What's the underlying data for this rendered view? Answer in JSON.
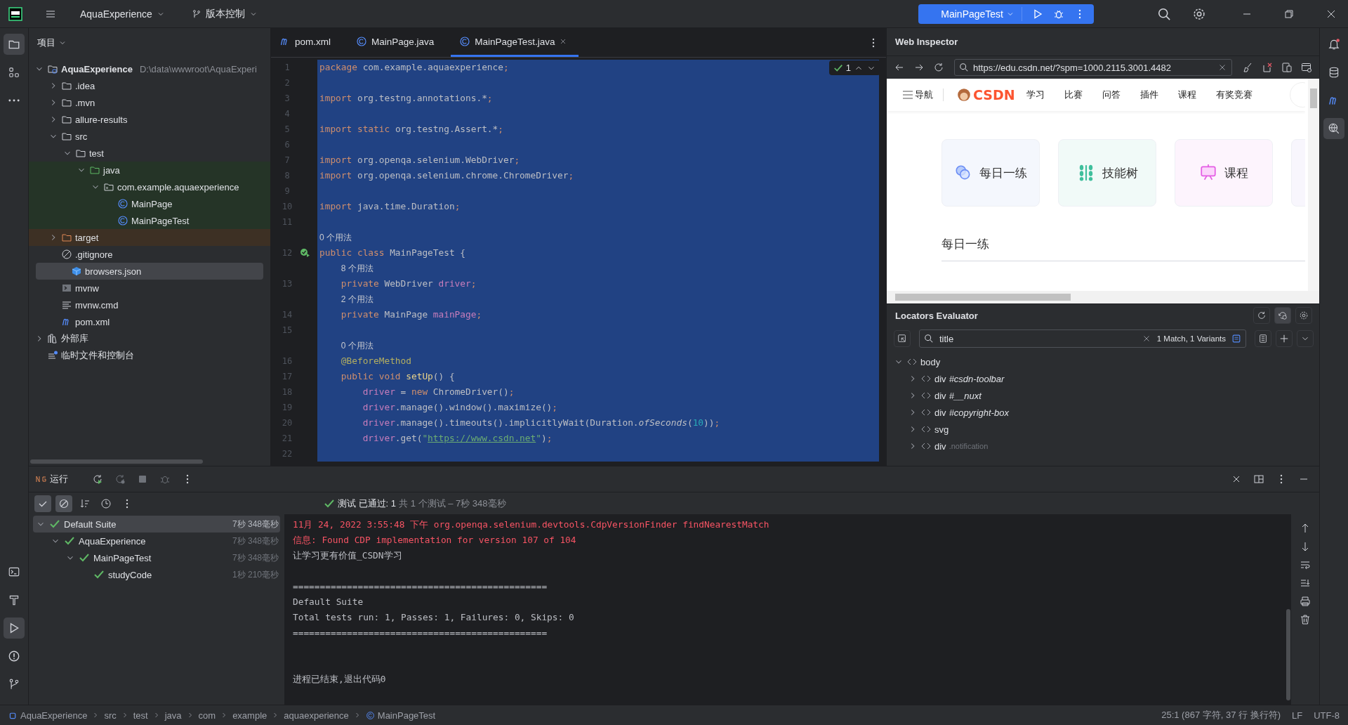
{
  "title_bar": {
    "project": "AquaExperience",
    "vcs": "版本控制",
    "run_config": "MainPageTest"
  },
  "tool_windows": {
    "left_top": [
      {
        "kind": "project",
        "selected": true
      },
      {
        "kind": "structure",
        "selected": false
      },
      {
        "kind": "more",
        "selected": false
      }
    ],
    "left_bottom": [
      {
        "kind": "terminal",
        "selected": false
      },
      {
        "kind": "build",
        "selected": false
      },
      {
        "kind": "run",
        "selected": true
      },
      {
        "kind": "problems",
        "selected": false
      },
      {
        "kind": "git",
        "selected": false
      }
    ],
    "right": [
      {
        "kind": "notifications",
        "selected": false
      },
      {
        "kind": "database",
        "selected": false
      },
      {
        "kind": "maven",
        "selected": false
      },
      {
        "kind": "inspector",
        "selected": true
      }
    ]
  },
  "project_panel": {
    "title": "项目",
    "tree": [
      {
        "name": "AquaExperience",
        "path": "D:\\data\\wwwroot\\AquaExperi",
        "kind": "module",
        "expanded": true,
        "selected": false,
        "children": [
          {
            "name": ".idea",
            "kind": "folder",
            "expanded": false,
            "selected": false
          },
          {
            "name": ".mvn",
            "kind": "folder",
            "expanded": false,
            "selected": false
          },
          {
            "name": "allure-results",
            "kind": "folder",
            "expanded": false,
            "selected": false
          },
          {
            "name": "src",
            "kind": "folder",
            "expanded": true,
            "selected": false,
            "children": [
              {
                "name": "test",
                "kind": "folder",
                "expanded": true,
                "selected": false,
                "children": [
                  {
                    "name": "java",
                    "kind": "source",
                    "test_scope": true,
                    "expanded": true,
                    "selected": false,
                    "children": [
                      {
                        "name": "com.example.aquaexperience",
                        "kind": "package",
                        "test_scope": true,
                        "expanded": true,
                        "selected": false,
                        "children": [
                          {
                            "name": "MainPage",
                            "kind": "class",
                            "test_scope": true,
                            "selected": false
                          },
                          {
                            "name": "MainPageTest",
                            "kind": "class",
                            "test_scope": true,
                            "selected": false
                          }
                        ]
                      }
                    ]
                  }
                ]
              }
            ]
          },
          {
            "name": "target",
            "kind": "excluded",
            "expanded": false,
            "selected": false
          },
          {
            "name": ".gitignore",
            "kind": "gitignore",
            "selected": false
          },
          {
            "name": "browsers.json",
            "kind": "json",
            "selected": true
          },
          {
            "name": "mvnw",
            "kind": "shell",
            "selected": false
          },
          {
            "name": "mvnw.cmd",
            "kind": "text",
            "selected": false
          },
          {
            "name": "pom.xml",
            "kind": "maven",
            "selected": false
          }
        ]
      },
      {
        "name": "外部库",
        "kind": "library",
        "expanded": false,
        "selected": false
      },
      {
        "name": "临时文件和控制台",
        "kind": "scratch",
        "selected": false
      }
    ]
  },
  "editor": {
    "tabs": [
      {
        "label": "pom.xml",
        "kind": "maven",
        "selected": false,
        "closable": false
      },
      {
        "label": "MainPage.java",
        "kind": "class",
        "selected": false,
        "closable": false
      },
      {
        "label": "MainPageTest.java",
        "kind": "class",
        "selected": true,
        "closable": true
      }
    ],
    "inspections": "1",
    "lines": [
      {
        "kind": "code",
        "number": "1",
        "tokens": [
          {
            "text": "package",
            "kind": "kw"
          },
          {
            "text": " com.example.aquaexperience",
            "kind": "plain"
          },
          {
            "text": ";",
            "kind": "kw"
          }
        ]
      },
      {
        "kind": "code",
        "number": "2"
      },
      {
        "kind": "code",
        "number": "3",
        "tokens": [
          {
            "text": "import",
            "kind": "kw"
          },
          {
            "text": " org.testng.annotations.*",
            "kind": "plain"
          },
          {
            "text": ";",
            "kind": "kw"
          }
        ]
      },
      {
        "kind": "code",
        "number": "4"
      },
      {
        "kind": "code",
        "number": "5",
        "tokens": [
          {
            "text": "import static",
            "kind": "kw"
          },
          {
            "text": " org.testng.Assert.*",
            "kind": "plain"
          },
          {
            "text": ";",
            "kind": "kw"
          }
        ]
      },
      {
        "kind": "code",
        "number": "6"
      },
      {
        "kind": "code",
        "number": "7",
        "tokens": [
          {
            "text": "import",
            "kind": "kw"
          },
          {
            "text": " org.openqa.selenium.WebDriver",
            "kind": "plain"
          },
          {
            "text": ";",
            "kind": "kw"
          }
        ]
      },
      {
        "kind": "code",
        "number": "8",
        "tokens": [
          {
            "text": "import",
            "kind": "kw"
          },
          {
            "text": " org.openqa.selenium.chrome.ChromeDriver",
            "kind": "plain"
          },
          {
            "text": ";",
            "kind": "kw"
          }
        ]
      },
      {
        "kind": "code",
        "number": "9"
      },
      {
        "kind": "code",
        "number": "10",
        "tokens": [
          {
            "text": "import",
            "kind": "kw"
          },
          {
            "text": " java.time.Duration",
            "kind": "plain"
          },
          {
            "text": ";",
            "kind": "kw"
          }
        ]
      },
      {
        "kind": "code",
        "number": "11"
      },
      {
        "kind": "hint",
        "text": "0 个用法"
      },
      {
        "kind": "code",
        "number": "12",
        "runnable": true,
        "tokens": [
          {
            "text": "public class",
            "kind": "kw"
          },
          {
            "text": " MainPageTest {",
            "kind": "plain"
          }
        ],
        "children": [
          {
            "kind": "hint",
            "text": "8 个用法"
          },
          {
            "kind": "code",
            "number": "13",
            "tokens": [
              {
                "text": "private",
                "kind": "kw"
              },
              {
                "text": " WebDriver ",
                "kind": "plain"
              },
              {
                "text": "driver",
                "kind": "field"
              },
              {
                "text": ";",
                "kind": "kw"
              }
            ]
          },
          {
            "kind": "hint",
            "text": "2 个用法"
          },
          {
            "kind": "code",
            "number": "14",
            "tokens": [
              {
                "text": "private",
                "kind": "kw"
              },
              {
                "text": " MainPage ",
                "kind": "plain"
              },
              {
                "text": "mainPage",
                "kind": "field"
              },
              {
                "text": ";",
                "kind": "kw"
              }
            ]
          },
          {
            "kind": "code",
            "number": "15"
          },
          {
            "kind": "hint",
            "text": "0 个用法"
          },
          {
            "kind": "code",
            "number": "16",
            "tokens": [
              {
                "text": "@BeforeMethod",
                "kind": "ann"
              }
            ]
          },
          {
            "kind": "code",
            "number": "17",
            "tokens": [
              {
                "text": "public void ",
                "kind": "kw"
              },
              {
                "text": "setUp",
                "kind": "decl"
              },
              {
                "text": "() {",
                "kind": "plain"
              }
            ],
            "children": [
              {
                "kind": "code",
                "number": "18",
                "tokens": [
                  {
                    "text": "driver",
                    "kind": "field"
                  },
                  {
                    "text": " = ",
                    "kind": "plain"
                  },
                  {
                    "text": "new",
                    "kind": "kw"
                  },
                  {
                    "text": " ChromeDriver()",
                    "kind": "plain"
                  },
                  {
                    "text": ";",
                    "kind": "kw"
                  }
                ]
              },
              {
                "kind": "code",
                "number": "19",
                "tokens": [
                  {
                    "text": "driver",
                    "kind": "field"
                  },
                  {
                    "text": ".manage().window().maximize()",
                    "kind": "plain"
                  },
                  {
                    "text": ";",
                    "kind": "kw"
                  }
                ]
              },
              {
                "kind": "code",
                "number": "20",
                "tokens": [
                  {
                    "text": "driver",
                    "kind": "field"
                  },
                  {
                    "text": ".manage().timeouts().implicitlyWait(Duration.",
                    "kind": "plain"
                  },
                  {
                    "text": "ofSeconds",
                    "kind": "italic"
                  },
                  {
                    "text": "(",
                    "kind": "plain"
                  },
                  {
                    "text": "10",
                    "kind": "num"
                  },
                  {
                    "text": "))",
                    "kind": "plain"
                  },
                  {
                    "text": ";",
                    "kind": "kw"
                  }
                ]
              },
              {
                "kind": "code",
                "number": "21",
                "tokens": [
                  {
                    "text": "driver",
                    "kind": "field"
                  },
                  {
                    "text": ".get(",
                    "kind": "plain"
                  },
                  {
                    "text": "\"",
                    "kind": "str"
                  },
                  {
                    "text": "https://www.csdn.net",
                    "kind": "link"
                  },
                  {
                    "text": "\"",
                    "kind": "str"
                  },
                  {
                    "text": ")",
                    "kind": "plain"
                  },
                  {
                    "text": ";",
                    "kind": "kw"
                  }
                ]
              },
              {
                "kind": "code",
                "number": "22"
              }
            ]
          }
        ]
      }
    ]
  },
  "web_inspector": {
    "title": "Web Inspector",
    "url": "https://edu.csdn.net/?spm=1000.2115.3001.4482",
    "page": {
      "nav_label": "导航",
      "logo": "CSDN",
      "nav": [
        "学习",
        "比赛",
        "问答",
        "插件",
        "课程",
        "有奖竞赛"
      ],
      "cards": [
        {
          "label": "每日一练",
          "kind": "practice"
        },
        {
          "label": "技能树",
          "kind": "skill"
        },
        {
          "label": "课程",
          "kind": "course"
        }
      ],
      "heading": "每日一练"
    }
  },
  "locators": {
    "title": "Locators Evaluator",
    "query": "title",
    "result": "1 Match, 1 Variants",
    "tree": [
      {
        "tag": "body",
        "expanded": true,
        "children": [
          {
            "tag": "div",
            "selector": "#csdn-toolbar",
            "kind": "id",
            "expanded": false
          },
          {
            "tag": "div",
            "selector": "#__nuxt",
            "kind": "id",
            "expanded": false
          },
          {
            "tag": "div",
            "selector": "#copyright-box",
            "kind": "id",
            "expanded": false
          },
          {
            "tag": "svg",
            "expanded": false
          },
          {
            "tag": "div",
            "selector": ".notification",
            "kind": "class",
            "expanded": false
          }
        ]
      }
    ]
  },
  "run_panel": {
    "tab": "运行",
    "filters": [
      {
        "kind": "passed",
        "on": true
      },
      {
        "kind": "ignored",
        "on": true
      }
    ],
    "summary": "测试 已通过: 1",
    "summary_detail": "共 1 个测试 – 7秒 348毫秒",
    "tests": [
      {
        "name": "Default Suite",
        "time": "7秒 348毫秒",
        "passed": true,
        "expanded": true,
        "selected": true,
        "children": [
          {
            "name": "AquaExperience",
            "time": "7秒 348毫秒",
            "passed": true,
            "expanded": true,
            "selected": false,
            "children": [
              {
                "name": "MainPageTest",
                "time": "7秒 348毫秒",
                "passed": true,
                "expanded": true,
                "selected": false,
                "children": [
                  {
                    "name": "studyCode",
                    "time": "1秒 210毫秒",
                    "passed": true,
                    "selected": false
                  }
                ]
              }
            ]
          }
        ]
      }
    ],
    "console": [
      {
        "kind": "error",
        "text": "11月 24, 2022 3:55:48 下午 org.openqa.selenium.devtools.CdpVersionFinder findNearestMatch"
      },
      {
        "kind": "error",
        "text": "信息: Found CDP implementation for version 107 of 104"
      },
      {
        "kind": "output",
        "text": "让学习更有价值_CSDN学习"
      },
      {
        "kind": "blank"
      },
      {
        "kind": "output",
        "text": "==============================================="
      },
      {
        "kind": "output",
        "text": "Default Suite"
      },
      {
        "kind": "output",
        "text": "Total tests run: 1, Passes: 1, Failures: 0, Skips: 0"
      },
      {
        "kind": "output",
        "text": "==============================================="
      },
      {
        "kind": "blank"
      },
      {
        "kind": "blank"
      },
      {
        "kind": "output",
        "text": "进程已结束,退出代码0"
      }
    ]
  },
  "status_bar": {
    "breadcrumbs": [
      {
        "label": "AquaExperience",
        "kind": "module"
      },
      {
        "label": "src",
        "kind": "plain"
      },
      {
        "label": "test",
        "kind": "plain"
      },
      {
        "label": "java",
        "kind": "plain"
      },
      {
        "label": "com",
        "kind": "plain"
      },
      {
        "label": "example",
        "kind": "plain"
      },
      {
        "label": "aquaexperience",
        "kind": "plain"
      },
      {
        "label": "MainPageTest",
        "kind": "class"
      }
    ],
    "position": "25:1 (867 字符, 37 行 换行符)",
    "line_separator": "LF",
    "encoding": "UTF-8"
  }
}
